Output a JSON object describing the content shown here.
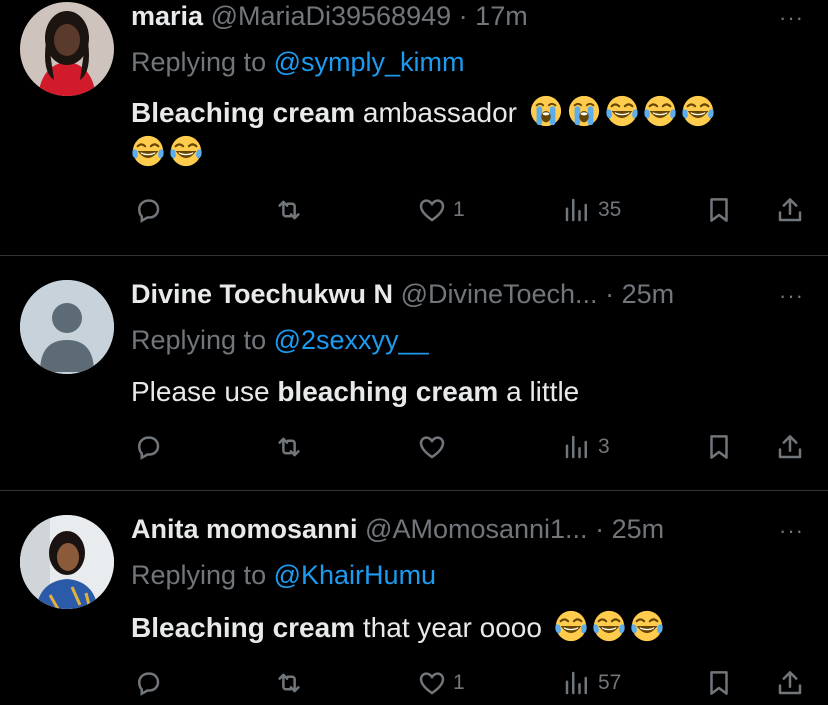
{
  "tweets": [
    {
      "name": "maria",
      "handle": "@MariaDi39568949",
      "dot": "·",
      "time": "17m",
      "more": "···",
      "replying_prefix": "Replying to",
      "replying_to": "@symply_kimm",
      "text_bold": "Bleaching cream",
      "text_rest": " ambassador",
      "emojis": [
        "crying-face",
        "crying-face",
        "laughing-tears",
        "laughing-tears",
        "laughing-tears",
        "laughing-tears",
        "laughing-tears"
      ],
      "likes": "1",
      "views": "35"
    },
    {
      "name": "Divine Toechukwu N",
      "handle": "@DivineToech...",
      "dot": "·",
      "time": "25m",
      "more": "···",
      "replying_prefix": "Replying to",
      "replying_to": "@2sexxyy__",
      "text_pre": "Please use ",
      "text_bold": "bleaching cream",
      "text_rest": " a little",
      "likes": "",
      "views": "3"
    },
    {
      "name": "Anita momosanni",
      "handle": "@AMomosanni1...",
      "dot": "·",
      "time": "25m",
      "more": "···",
      "replying_prefix": "Replying to",
      "replying_to": "@KhairHumu",
      "text_bold": "Bleaching cream",
      "text_rest": " that year oooo",
      "emojis": [
        "laughing-tears",
        "laughing-tears",
        "laughing-tears"
      ],
      "likes": "1",
      "views": "57"
    }
  ],
  "colors": {
    "background": "#000000",
    "text": "#e7e9ea",
    "muted": "#71767b",
    "link": "#1d9bf0",
    "divider": "#2f3336"
  }
}
